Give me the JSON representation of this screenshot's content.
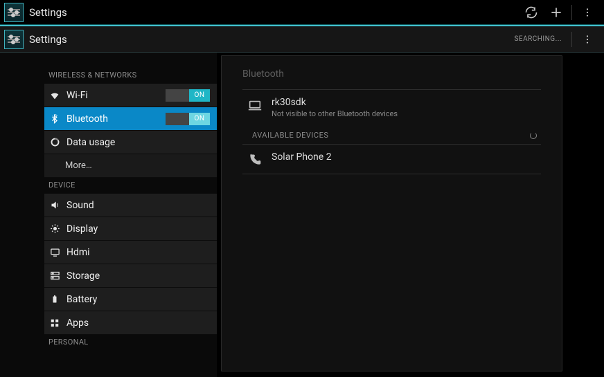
{
  "actionbar1": {
    "title": "Settings"
  },
  "actionbar2": {
    "title": "Settings",
    "status": "SEARCHING..."
  },
  "sidebar": {
    "sec_wireless": "WIRELESS & NETWORKS",
    "wifi": {
      "label": "Wi-Fi",
      "toggle": "ON"
    },
    "bluetooth": {
      "label": "Bluetooth",
      "toggle": "ON"
    },
    "datausage": {
      "label": "Data usage"
    },
    "more": {
      "label": "More…"
    },
    "sec_device": "DEVICE",
    "sound": {
      "label": "Sound"
    },
    "display": {
      "label": "Display"
    },
    "hdmi": {
      "label": "Hdmi"
    },
    "storage": {
      "label": "Storage"
    },
    "battery": {
      "label": "Battery"
    },
    "apps": {
      "label": "Apps"
    },
    "sec_personal": "PERSONAL"
  },
  "detail": {
    "title": "Bluetooth",
    "device": {
      "name": "rk30sdk",
      "sub": "Not visible to other Bluetooth devices"
    },
    "available_header": "AVAILABLE DEVICES",
    "found": [
      {
        "name": "Solar Phone 2"
      }
    ]
  }
}
